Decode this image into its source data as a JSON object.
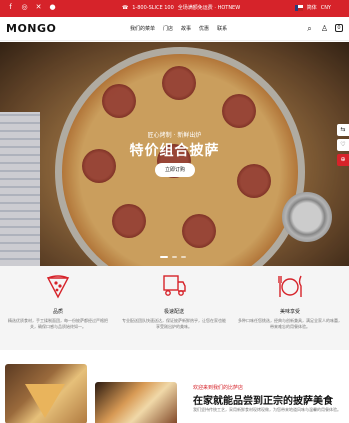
{
  "topbar": {
    "social_icons": [
      "facebook-icon",
      "instagram-icon",
      "x-twitter-icon",
      "tripadvisor-icon"
    ],
    "phone": "1-800-SLICE 100",
    "promo": "全场满额免运费 · HOTNEW",
    "language": "简体",
    "currency": "CNY"
  },
  "header": {
    "logo": "MONGO",
    "nav": [
      "我们的菜单",
      "门店",
      "故事",
      "优惠",
      "联系"
    ],
    "icons": [
      "search-icon",
      "user-icon",
      "cart-icon"
    ],
    "cart_count": "0"
  },
  "hero": {
    "subtitle": "匠心烤制 · 新鲜出炉",
    "title": "特价组合披萨",
    "button": "立即订购",
    "slides": 3,
    "active_slide": 0
  },
  "features": [
    {
      "icon": "pizza-icon",
      "title": "品质",
      "desc": "精选优质食材，手工揉制面团，每一份披萨都经过严格把关，确保口感与品质始终如一。"
    },
    {
      "icon": "delivery-icon",
      "title": "极速配送",
      "desc": "专业配送团队快速送达，保证披萨新鲜热乎，让您在家也能享受刚出炉的美味。"
    },
    {
      "icon": "dining-icon",
      "title": "美味享受",
      "desc": "多种口味任您挑选，经典与创新兼具，满足全家人的味蕾，带来难忘的用餐体验。"
    }
  ],
  "bottom": {
    "label": "欢迎来到我们的比萨店",
    "title": "在家就能品尝到正宗的披萨美食",
    "desc": "我们坚持传统工艺，采用新鲜食材现烤现做，为您带来地道风味与温馨的用餐体验。"
  },
  "colors": {
    "accent": "#d6232a"
  }
}
